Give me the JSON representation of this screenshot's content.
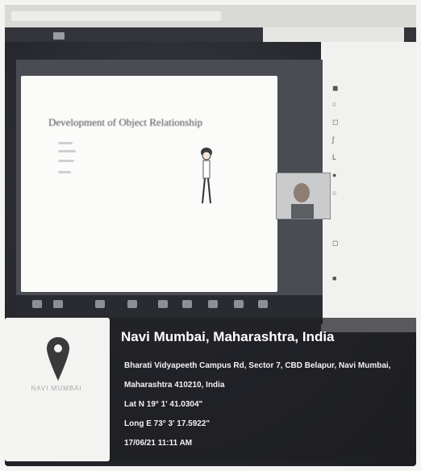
{
  "presentation": {
    "slide_title": "Development of Object Relationship"
  },
  "location": {
    "city_line": "Navi Mumbai, Maharashtra, India",
    "address_line1": "Bharati Vidyapeeth Campus Rd, Sector 7, CBD Belapur, Navi Mumbai,",
    "address_line2": "Maharashtra 410210, India",
    "latitude": "Lat N 19° 1' 41.0304\"",
    "longitude": "Long E 73° 3' 17.5922\"",
    "timestamp": "17/06/21 11:11 AM",
    "map_label": "NAVI MUMBAI"
  },
  "icons": {
    "pin": "location-pin-icon"
  },
  "colors": {
    "pin": "#3a3a3a",
    "overlay_text": "#ffffff"
  }
}
